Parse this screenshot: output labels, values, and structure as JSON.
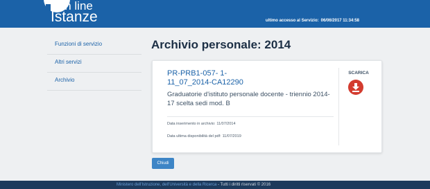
{
  "header": {
    "logo_top": "On line",
    "logo_bottom": "Istanze",
    "last_access_label": "ultimo accesso al Servizio:",
    "last_access_value": "06/06/2017 11:34:58",
    "color": "#1b62a8"
  },
  "sidebar": {
    "items": [
      {
        "label": "Funzioni di servizio"
      },
      {
        "label": "Altri servizi"
      },
      {
        "label": "Archivio"
      }
    ]
  },
  "main": {
    "title": "Archivio personale: 2014"
  },
  "card": {
    "code_line1": "PR-PRB1-057-                 1-",
    "code_line2": "11_07_2014-CA12290",
    "title": "Graduatorie d'istituto personale docente - triennio 2014-17 scelta sedi mod. B",
    "insert_label": "Data inserimento in archivio:",
    "insert_value": "11/07/2014",
    "availability_label": "Data ultima disponibilità del pdf:",
    "availability_value": "11/07/2019",
    "download_label": "SCARICA",
    "download_icon": "download-arrow-icon",
    "download_color": "#d33c2f"
  },
  "actions": {
    "close_label": "Chiudi"
  },
  "footer": {
    "link_text": "Ministero dell'Istruzione, dell'Università e della Ricerca",
    "rights_text": " - Tutti i diritti riservati © 2016"
  }
}
